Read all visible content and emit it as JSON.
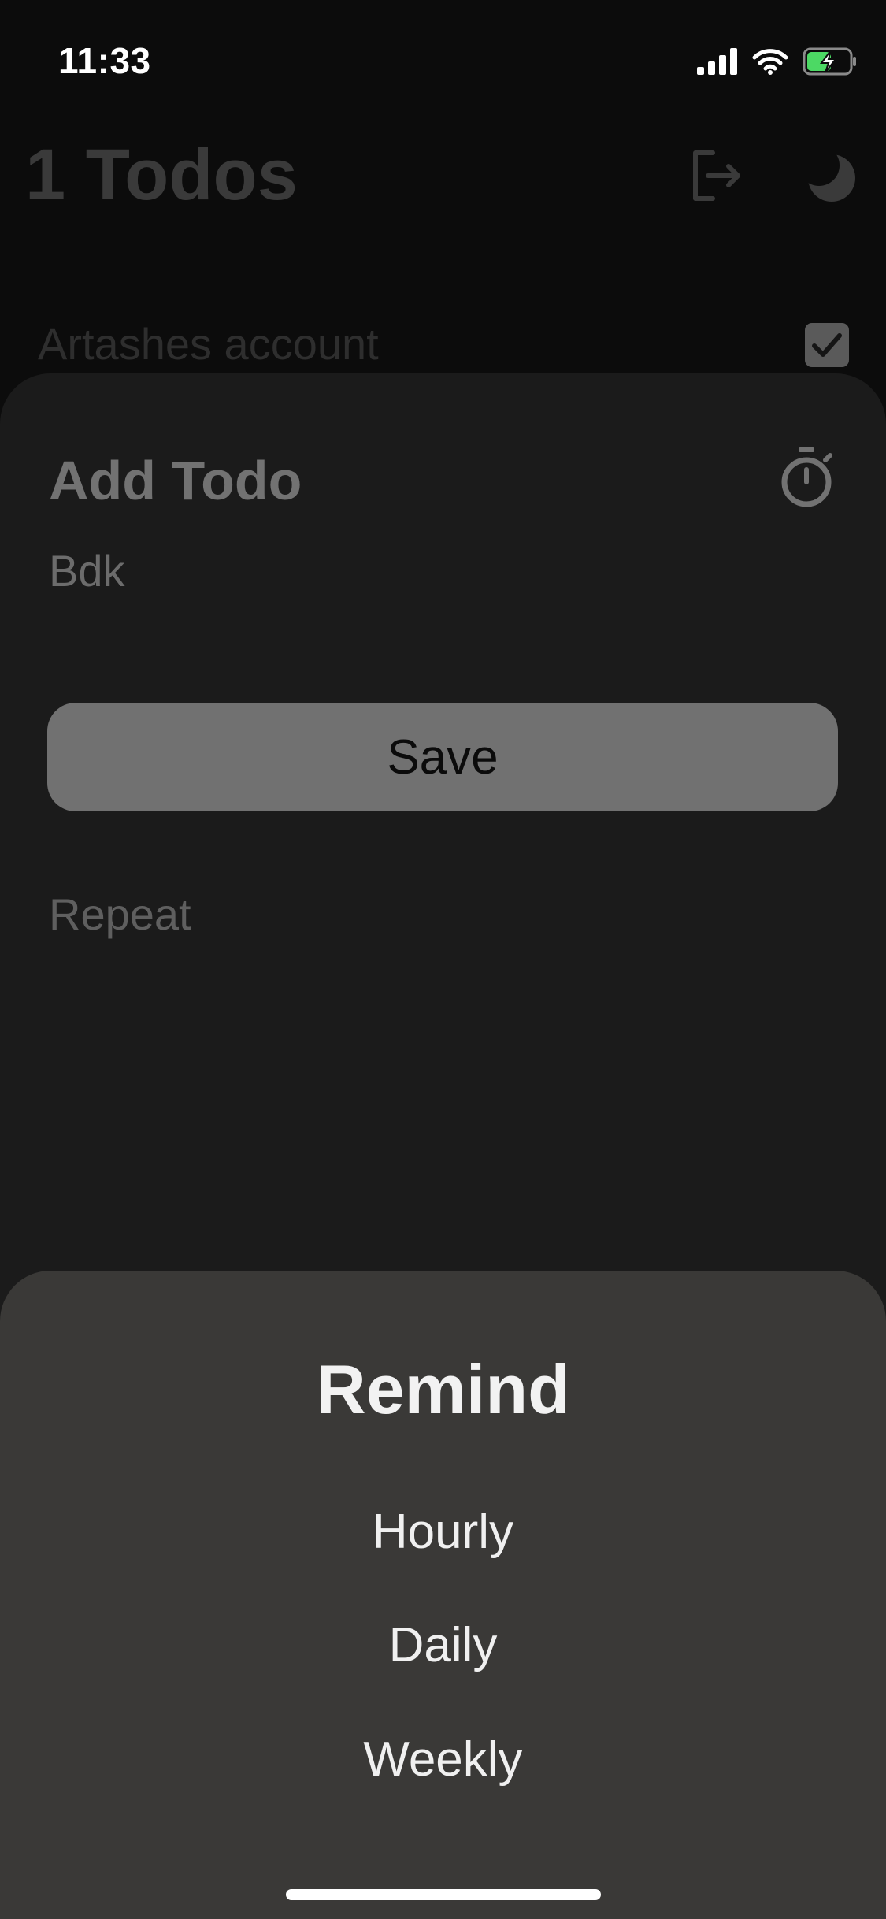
{
  "status_bar": {
    "time": "11:33",
    "icons": [
      "cellular-signal-icon",
      "wifi-icon",
      "battery-charging-icon"
    ]
  },
  "background_screen": {
    "title": "1 Todos",
    "icons": [
      "logout-icon",
      "moon-icon"
    ],
    "items": [
      {
        "label": "Artashes account",
        "checked": true
      }
    ]
  },
  "add_todo": {
    "title": "Add Todo",
    "icon": "timer-icon",
    "input_value": "Bdk",
    "save_label": "Save",
    "repeat_label": "Repeat"
  },
  "remind_sheet": {
    "title": "Remind",
    "options": [
      "Hourly",
      "Daily",
      "Weekly"
    ]
  },
  "colors": {
    "sheet_bg": "#1b1b1b",
    "remind_bg": "#3a3937",
    "save_bg": "#717171",
    "battery_green": "#4cd964"
  }
}
